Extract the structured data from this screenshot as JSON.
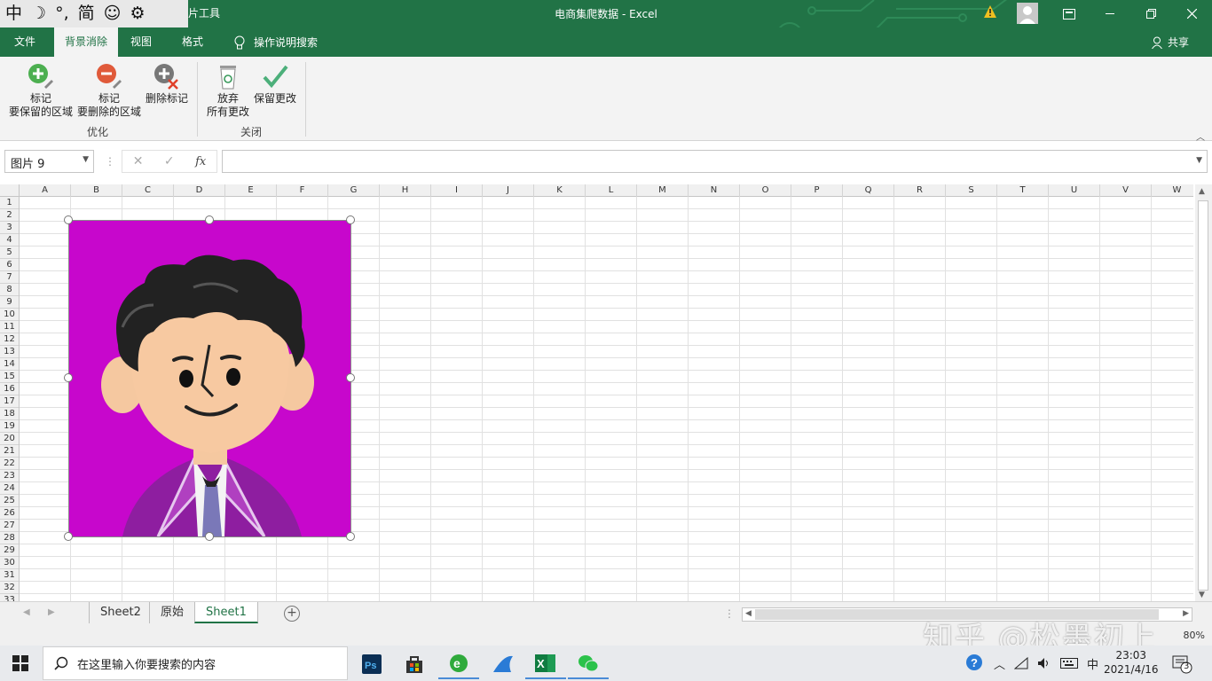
{
  "ime": {
    "chars": [
      "中",
      "☽",
      "°,",
      "简",
      "☺",
      "⚙"
    ]
  },
  "title_bar": {
    "context_tools": "片工具",
    "title": "电商集爬数据  -  Excel"
  },
  "tabs": [
    {
      "label": "文件"
    },
    {
      "label": "背景消除"
    },
    {
      "label": "视图"
    },
    {
      "label": "格式"
    }
  ],
  "tell_me": "操作说明搜索",
  "share": "共享",
  "ribbon": {
    "mark_keep": {
      "line1": "标记",
      "line2": "要保留的区域"
    },
    "mark_remove": {
      "line1": "标记",
      "line2": "要删除的区域"
    },
    "delete_mark": "删除标记",
    "discard": {
      "line1": "放弃",
      "line2": "所有更改"
    },
    "keep_changes": "保留更改",
    "group_refine": "优化",
    "group_close": "关闭"
  },
  "formula_bar": {
    "name_box": "图片 9",
    "formula": "",
    "fx": "fx",
    "dots": "⋮"
  },
  "columns": [
    "A",
    "B",
    "C",
    "D",
    "E",
    "F",
    "G",
    "H",
    "I",
    "J",
    "K",
    "L",
    "M",
    "N",
    "O",
    "P",
    "Q",
    "R",
    "S",
    "T",
    "U",
    "V",
    "W"
  ],
  "rows": [
    "1",
    "2",
    "3",
    "4",
    "5",
    "6",
    "7",
    "8",
    "9",
    "10",
    "11",
    "12",
    "13",
    "14",
    "15",
    "16",
    "17",
    "18",
    "19",
    "20",
    "21",
    "22",
    "23",
    "24",
    "25",
    "26",
    "27",
    "28",
    "29",
    "30",
    "31",
    "32",
    "33"
  ],
  "sheets": [
    {
      "label": "Sheet2"
    },
    {
      "label": "原始"
    },
    {
      "label": "Sheet1"
    }
  ],
  "status": {
    "zoom": "80%",
    "watermark": "知乎 @松墨初上"
  },
  "taskbar": {
    "search_placeholder": "在这里输入你要搜索的内容",
    "time": "23:03",
    "date": "2021/4/16",
    "ime": "中",
    "notifications": "3"
  },
  "colors": {
    "excel_green": "#217346",
    "picture_bg": "#c400c8"
  }
}
